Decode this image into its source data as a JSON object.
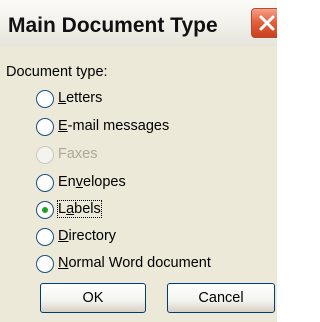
{
  "dialog": {
    "title": "Main Document Type",
    "close_icon": "close-icon",
    "group_label": "Document type:",
    "options": [
      {
        "before": "",
        "mnemonic": "L",
        "after": "etters",
        "enabled": true,
        "selected": false
      },
      {
        "before": "",
        "mnemonic": "E",
        "after": "-mail messages",
        "enabled": true,
        "selected": false
      },
      {
        "before": "Faxes",
        "mnemonic": "",
        "after": "",
        "enabled": false,
        "selected": false
      },
      {
        "before": "En",
        "mnemonic": "v",
        "after": "elopes",
        "enabled": true,
        "selected": false
      },
      {
        "before": "L",
        "mnemonic": "a",
        "after": "bels",
        "enabled": true,
        "selected": true
      },
      {
        "before": "",
        "mnemonic": "D",
        "after": "irectory",
        "enabled": true,
        "selected": false
      },
      {
        "before": "",
        "mnemonic": "N",
        "after": "ormal Word document",
        "enabled": true,
        "selected": false
      }
    ],
    "ok_label": "OK",
    "cancel_label": "Cancel"
  },
  "colors": {
    "title_bar": "#f1f0ea",
    "dialog_bg": "#ece9d8",
    "close_button": "#e4623e",
    "radio_selected_dot": "#21a121",
    "disabled_text": "#aca899"
  }
}
